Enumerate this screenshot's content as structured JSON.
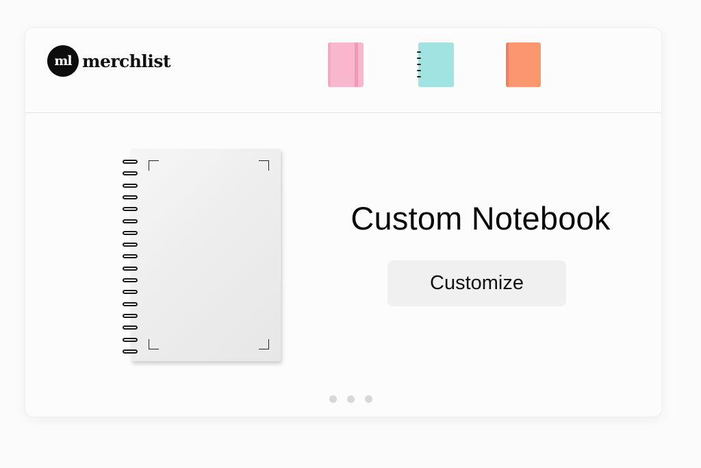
{
  "brand": {
    "mark": "ml",
    "name": "merchlist"
  },
  "thumbnails": [
    {
      "name": "pink notebook",
      "color": "#f9b7cd"
    },
    {
      "name": "teal spiral notebook",
      "color": "#a1e3e0"
    },
    {
      "name": "orange notebook",
      "color": "#fb9670"
    }
  ],
  "product": {
    "title": "Custom Notebook",
    "cta_label": "Customize"
  },
  "carousel": {
    "page_count": 3
  }
}
